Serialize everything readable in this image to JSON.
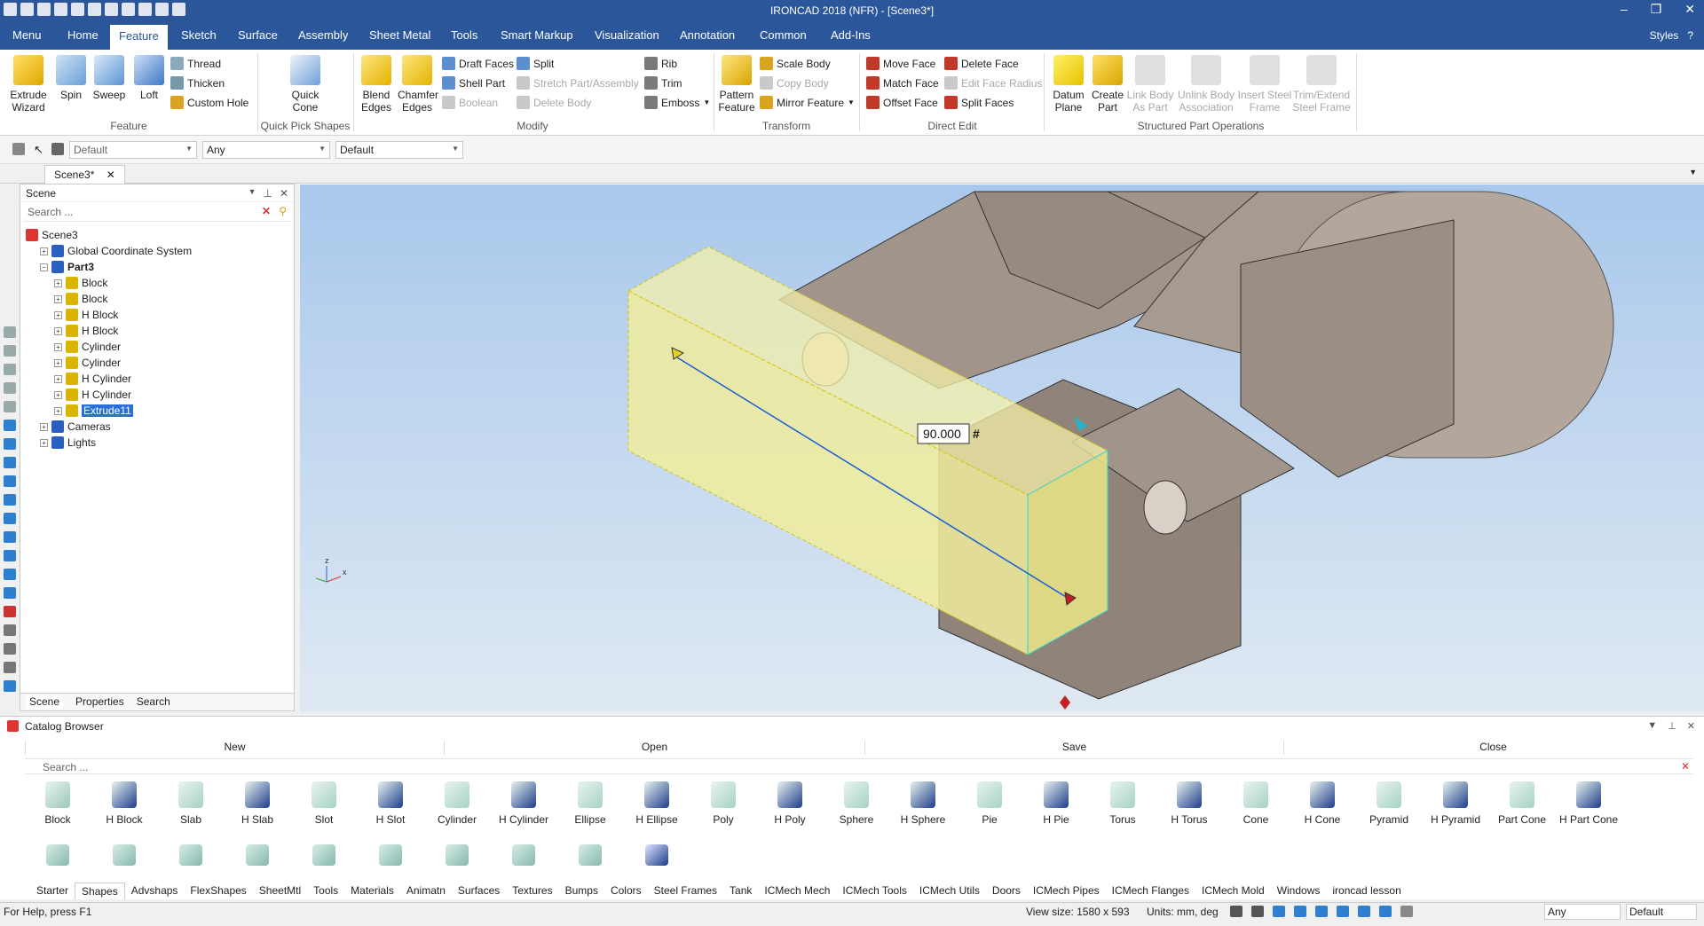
{
  "window": {
    "title": "IRONCAD 2018 (NFR) - [Scene3*]",
    "controls": [
      "–",
      "❐",
      "✕"
    ]
  },
  "menubar": {
    "tabs": [
      "Menu",
      "Home",
      "Feature",
      "Sketch",
      "Surface",
      "Assembly",
      "Sheet Metal",
      "Tools",
      "Smart Markup",
      "Visualization",
      "Annotation",
      "Common",
      "Add-Ins"
    ],
    "active": "Feature",
    "styles_label": "Styles"
  },
  "ribbon": {
    "feature": {
      "extrude": "Extrude Wizard",
      "spin": "Spin",
      "sweep": "Sweep",
      "loft": "Loft",
      "thread": "Thread",
      "thicken": "Thicken",
      "custom_hole": "Custom Hole",
      "label": "Feature"
    },
    "quick_pick": {
      "quick_cone": "Quick Cone",
      "label": "Quick Pick Shapes"
    },
    "modify": {
      "blend_edges": "Blend Edges",
      "chamfer_edges": "Chamfer Edges",
      "draft_faces": "Draft Faces",
      "shell_part": "Shell Part",
      "boolean": "Boolean",
      "split": "Split",
      "stretch": "Stretch Part/Assembly",
      "delete_body": "Delete Body",
      "rib": "Rib",
      "trim": "Trim",
      "emboss": "Emboss",
      "label": "Modify"
    },
    "transform": {
      "pattern": "Pattern Feature",
      "scale_body": "Scale Body",
      "copy_body": "Copy Body",
      "mirror": "Mirror Feature",
      "label": "Transform"
    },
    "direct_edit": {
      "move_face": "Move Face",
      "match_face": "Match Face",
      "offset_face": "Offset Face",
      "delete_face": "Delete Face",
      "edit_face_radius": "Edit Face Radius",
      "split_faces": "Split Faces",
      "label": "Direct Edit"
    },
    "structured": {
      "datum_plane": "Datum Plane",
      "create_part": "Create Part",
      "link_body": "Link Body As Part",
      "unlink_body": "Unlink Body Association",
      "insert_steel": "Insert Steel Frame",
      "trim_extend": "Trim/Extend Steel Frame",
      "label": "Structured Part Operations"
    }
  },
  "selection_bar": {
    "combo1": "Default",
    "combo2": "Any",
    "combo3": "Default"
  },
  "doc_tab": "Scene3*",
  "scene_panel": {
    "title": "Scene",
    "search_placeholder": "Search ...",
    "tree": [
      {
        "label": "Scene3",
        "level": 0,
        "bold": false,
        "exp": ""
      },
      {
        "label": "Global Coordinate System",
        "level": 1,
        "exp": "+"
      },
      {
        "label": "Part3",
        "level": 1,
        "bold": true,
        "exp": "−"
      },
      {
        "label": "Block",
        "level": 2,
        "exp": "+"
      },
      {
        "label": "Block",
        "level": 2,
        "exp": "+"
      },
      {
        "label": "H Block",
        "level": 2,
        "exp": "+"
      },
      {
        "label": "H Block",
        "level": 2,
        "exp": "+"
      },
      {
        "label": "Cylinder",
        "level": 2,
        "exp": "+"
      },
      {
        "label": "Cylinder",
        "level": 2,
        "exp": "+"
      },
      {
        "label": "H Cylinder",
        "level": 2,
        "exp": "+"
      },
      {
        "label": "H Cylinder",
        "level": 2,
        "exp": "+"
      },
      {
        "label": "Extrude11",
        "level": 2,
        "exp": "+",
        "selected": true
      },
      {
        "label": "Cameras",
        "level": 1,
        "exp": "+"
      },
      {
        "label": "Lights",
        "level": 1,
        "exp": "+"
      }
    ],
    "footer_tabs": [
      "Scene",
      "Properties",
      "Search"
    ]
  },
  "viewport": {
    "dimension_value": "90.000",
    "dimension_suffix": "#",
    "axis_z": "z",
    "axis_x": "x"
  },
  "catalog": {
    "title": "Catalog Browser",
    "buttons": [
      "New",
      "Open",
      "Save",
      "Close"
    ],
    "search_placeholder": "Search ...",
    "shapes": [
      "Block",
      "H Block",
      "Slab",
      "H Slab",
      "Slot",
      "H Slot",
      "Cylinder",
      "H Cylinder",
      "Ellipse",
      "H Ellipse",
      "Poly",
      "H Poly",
      "Sphere",
      "H Sphere",
      "Pie",
      "H Pie",
      "Torus",
      "H Torus",
      "Cone",
      "H Cone",
      "Pyramid",
      "H Pyramid",
      "Part Cone",
      "H Part Cone"
    ],
    "tabs": [
      "Starter",
      "Shapes",
      "Advshaps",
      "FlexShapes",
      "SheetMtl",
      "Tools",
      "Materials",
      "Animatn",
      "Surfaces",
      "Textures",
      "Bumps",
      "Colors",
      "Steel Frames",
      "Tank",
      "ICMech Mech",
      "ICMech Tools",
      "ICMech Utils",
      "Doors",
      "ICMech Pipes",
      "ICMech Flanges",
      "ICMech Mold",
      "Windows",
      "ironcad lesson"
    ],
    "active_tab": "Shapes"
  },
  "status": {
    "help": "For Help, press F1",
    "view_size": "View size: 1580 x 593",
    "units": "Units: mm, deg",
    "combo1": "Any",
    "combo2": "Default"
  }
}
